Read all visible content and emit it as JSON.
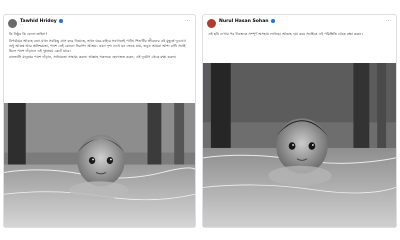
{
  "left_post": {
    "author": "Tawhid Hridoy",
    "meta": "· ·",
    "paragraphs": [
      "কি নিষ্ঠুর কি বেদনা তাইনা!",
      "বিপর্যয়ের আবহে বন্যা যখন সবকিছু গ্রাস করে নিয়েছে, তখন ঘরে-বাইরে সবখানেই পানি। শিশুটির জীবনের এই মুহূর্তে দুচোখে শুধু আতঙ্ক আর অনিশ্চয়তা, পাশে নেই কোনো নিরাপদ আশ্রয়। এমন দৃশ্য দেখে মন ভেঙে যায়, তবুও আমরা আশা রাখি সবাই মিলে পাশে দাঁড়ালে এই দুঃসময় কেটে যাবে।",
      "বানভাসি মানুষের পাশে দাঁড়ান, সাধ্যমতো সাহায্য করুন। আল্লাহ সকলকে হেফাজত করুন, এই দুর্যোগ থেকে রক্ষা করুন।"
    ]
  },
  "right_post": {
    "author": "Nurul Hasan Sohan",
    "meta": "· ·",
    "paragraphs": [
      "এই ছবি দেখার পর নিজেকে সম্পূর্ণ অসহায় লাগছে। আল্লাহ দয়া করে সবাইকে এই পরিস্থিতি থেকে রক্ষা করুন।"
    ]
  },
  "colors": {
    "verified": "#1b74e4",
    "border": "#dcdfe3"
  },
  "icons": [
    "menu-dots-icon",
    "verified-badge-icon"
  ]
}
